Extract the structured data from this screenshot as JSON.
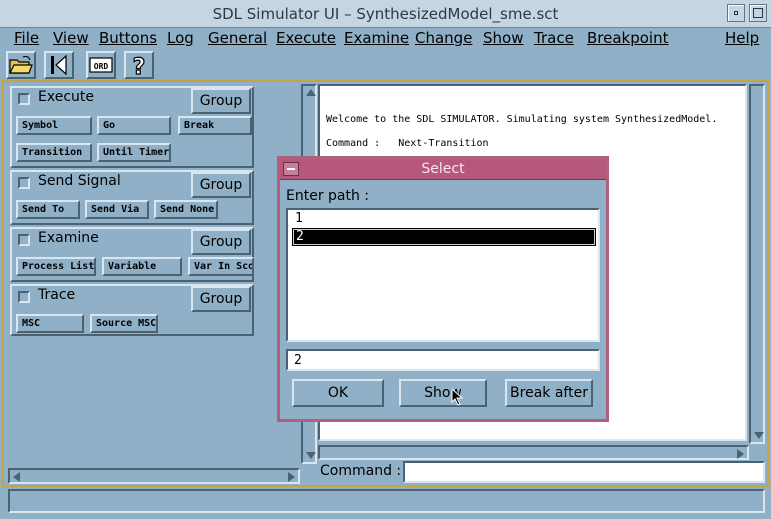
{
  "window": {
    "title": "SDL Simulator UI – SynthesizedModel_sme.sct"
  },
  "menubar": [
    "File",
    "View",
    "Buttons",
    "Log",
    "General",
    "Execute",
    "Examine",
    "Change",
    "Show",
    "Trace",
    "Breakpoint",
    "Help"
  ],
  "toolbar": {
    "icons": [
      "open-folder-icon",
      "step-back-icon",
      "ord-icon",
      "help-icon"
    ],
    "ord_text": "ORD",
    "help_text": "?"
  },
  "panels": {
    "execute": {
      "title": "Execute",
      "group": "Group",
      "buttons": [
        "Symbol",
        "Go",
        "Break",
        "Transition",
        "Until Timer"
      ]
    },
    "send_signal": {
      "title": "Send Signal",
      "group": "Group",
      "buttons": [
        "Send To",
        "Send Via",
        "Send None"
      ]
    },
    "examine": {
      "title": "Examine",
      "group": "Group",
      "buttons": [
        "Process List",
        "Variable",
        "Var In Sco"
      ]
    },
    "trace": {
      "title": "Trace",
      "group": "Group",
      "buttons": [
        "MSC",
        "Source MSC"
      ]
    }
  },
  "output": {
    "lines": [
      "Welcome to the SDL SIMULATOR. Simulating system SynthesizedModel.",
      "Command :   Next-Transition"
    ]
  },
  "command": {
    "label": "Command :",
    "value": ""
  },
  "dialog": {
    "title": "Select",
    "prompt": "Enter path :",
    "items": [
      "1",
      "2"
    ],
    "selected_index": 1,
    "input_value": "2",
    "buttons": {
      "ok": "OK",
      "show": "Show",
      "break_after": "Break after"
    }
  },
  "colors": {
    "background": "#8fb0c6",
    "dialog_title": "#b6587c",
    "frame": "#c6a347"
  }
}
